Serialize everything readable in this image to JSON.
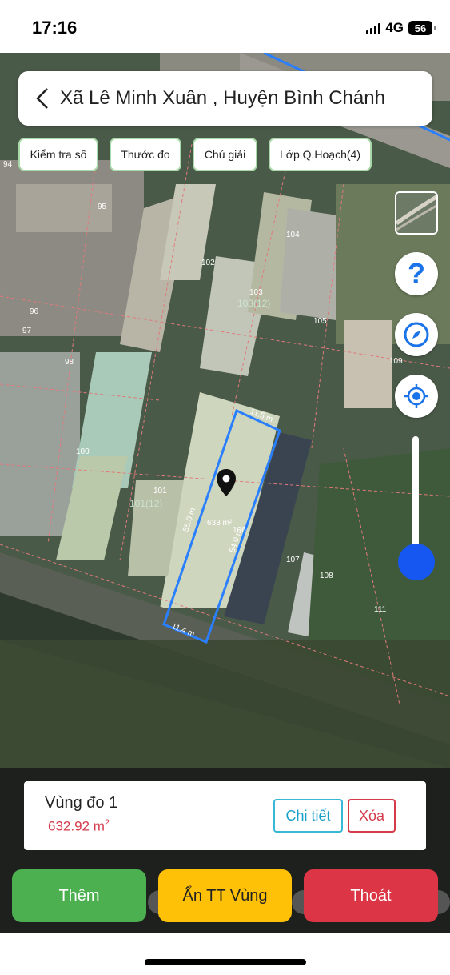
{
  "status_bar": {
    "time": "17:16",
    "network": "4G",
    "battery": "56"
  },
  "header": {
    "address": "Xã Lê Minh Xuân , Huyện Bình Chánh"
  },
  "chips": [
    {
      "label": "Kiểm tra số"
    },
    {
      "label": "Thước đo"
    },
    {
      "label": "Chú giải"
    },
    {
      "label": "Lớp Q.Hoạch(4)"
    }
  ],
  "map": {
    "plot_numbers": [
      "94",
      "95",
      "96",
      "97",
      "98",
      "100",
      "101",
      "102",
      "103",
      "104",
      "105",
      "106",
      "107",
      "108",
      "109",
      "111"
    ],
    "plot_sub_labels": [
      "103(12)",
      "101(12)"
    ],
    "measurement": {
      "side_top": "11.5 m",
      "side_left": "55.0 m",
      "side_right": "54.0 m",
      "side_bottom": "11.4 m",
      "area_label": "633 m²"
    },
    "colors": {
      "selection": "#2a7fff",
      "parcel_border": "#e07a7a",
      "pin": "#111111"
    }
  },
  "controls": {
    "help_icon": "question-icon",
    "compass_icon": "compass-icon",
    "locate_icon": "crosshair-icon",
    "zoom_level": 0.15
  },
  "area_card": {
    "name": "Vùng đo 1",
    "value": "632.92 m",
    "unit_exp": "2",
    "detail_label": "Chi tiết",
    "delete_label": "Xóa"
  },
  "actions": {
    "add_label": "Thêm",
    "hide_label": "Ẩn TT Vùng",
    "exit_label": "Thoát"
  }
}
